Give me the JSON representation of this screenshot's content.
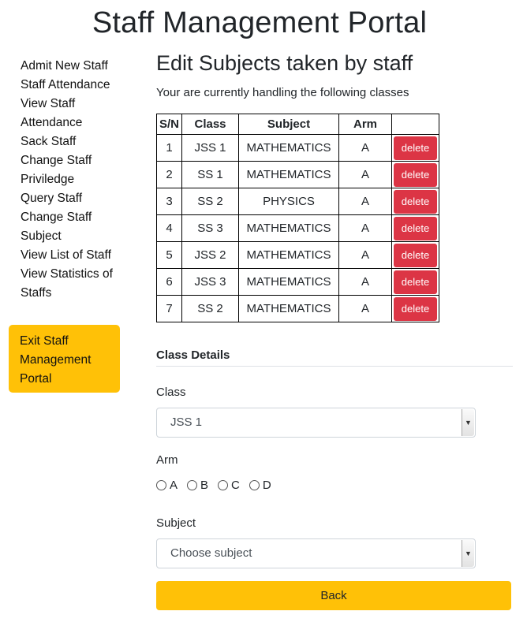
{
  "page": {
    "title": "Staff Management Portal"
  },
  "sidebar": {
    "items": [
      {
        "label": "Admit New Staff"
      },
      {
        "label": "Staff Attendance"
      },
      {
        "label": "View Staff Attendance"
      },
      {
        "label": "Sack Staff"
      },
      {
        "label": "Change Staff Priviledge"
      },
      {
        "label": "Query Staff"
      },
      {
        "label": "Change Staff Subject"
      },
      {
        "label": "View List of Staff"
      },
      {
        "label": "View Statistics of Staffs"
      }
    ],
    "exit": {
      "label": "Exit Staff Management Portal"
    }
  },
  "main": {
    "heading": "Edit Subjects taken by staff",
    "intro": "Your are currently handling the following classes"
  },
  "table": {
    "headers": {
      "sn": "S/N",
      "class": "Class",
      "subject": "Subject",
      "arm": "Arm"
    },
    "rows": [
      {
        "sn": "1",
        "class": "JSS 1",
        "subject": "MATHEMATICS",
        "arm": "A",
        "action": "delete"
      },
      {
        "sn": "2",
        "class": "SS 1",
        "subject": "MATHEMATICS",
        "arm": "A",
        "action": "delete"
      },
      {
        "sn": "3",
        "class": "SS 2",
        "subject": "PHYSICS",
        "arm": "A",
        "action": "delete"
      },
      {
        "sn": "4",
        "class": "SS 3",
        "subject": "MATHEMATICS",
        "arm": "A",
        "action": "delete"
      },
      {
        "sn": "5",
        "class": "JSS 2",
        "subject": "MATHEMATICS",
        "arm": "A",
        "action": "delete"
      },
      {
        "sn": "6",
        "class": "JSS 3",
        "subject": "MATHEMATICS",
        "arm": "A",
        "action": "delete"
      },
      {
        "sn": "7",
        "class": "SS 2",
        "subject": "MATHEMATICS",
        "arm": "A",
        "action": "delete"
      }
    ]
  },
  "form": {
    "section_title": "Class Details",
    "class_label": "Class",
    "class_value": "JSS 1",
    "arm_label": "Arm",
    "arm_options": [
      "A",
      "B",
      "C",
      "D"
    ],
    "subject_label": "Subject",
    "subject_value": "Choose subject",
    "back_label": "Back"
  },
  "colors": {
    "accent": "#ffc107",
    "danger": "#dc3545"
  },
  "icons": {
    "select_arrow": "chevron-down-icon",
    "radio": "radio-icon"
  }
}
